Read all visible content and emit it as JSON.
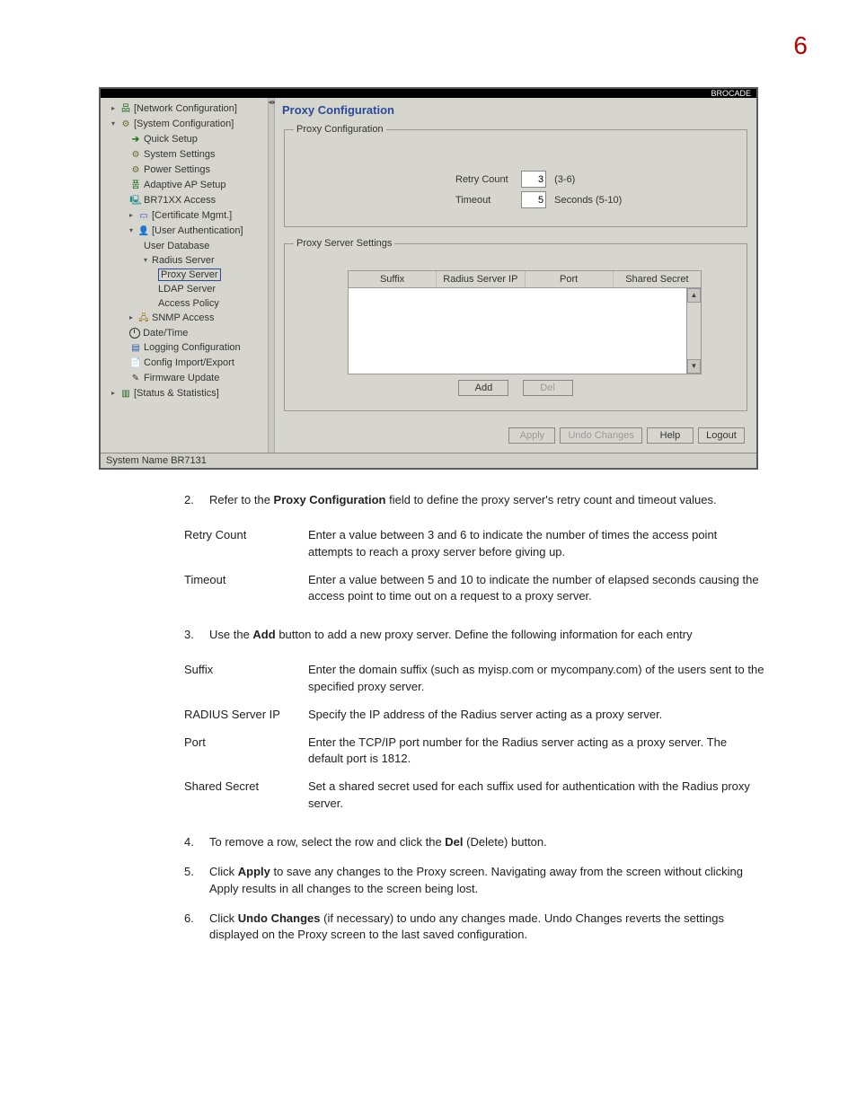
{
  "page_number": "6",
  "screenshot": {
    "brand": "BROCADE",
    "tree": {
      "network_config": "[Network Configuration]",
      "system_config": "[System Configuration]",
      "quick_setup": "Quick Setup",
      "system_settings": "System Settings",
      "power_settings": "Power Settings",
      "adaptive_ap": "Adaptive AP Setup",
      "br71xx": "BR71XX Access",
      "cert_mgmt": "[Certificate Mgmt.]",
      "user_auth": "[User Authentication]",
      "user_db": "User Database",
      "radius_server": "Radius Server",
      "proxy_server": "Proxy Server",
      "ldap_server": "LDAP Server",
      "access_policy": "Access Policy",
      "snmp": "SNMP Access",
      "datetime": "Date/Time",
      "logging": "Logging Configuration",
      "config_ie": "Config Import/Export",
      "firmware": "Firmware Update",
      "stats": "[Status & Statistics]"
    },
    "content": {
      "title": "Proxy Configuration",
      "group1_legend": "Proxy Configuration",
      "retry_label": "Retry Count",
      "retry_value": "3",
      "retry_hint": "(3-6)",
      "timeout_label": "Timeout",
      "timeout_value": "5",
      "timeout_hint": "Seconds (5-10)",
      "group2_legend": "Proxy Server Settings",
      "col_suffix": "Suffix",
      "col_radius": "Radius Server IP",
      "col_port": "Port",
      "col_secret": "Shared Secret",
      "btn_add": "Add",
      "btn_del": "Del",
      "btn_apply": "Apply",
      "btn_undo": "Undo Changes",
      "btn_help": "Help",
      "btn_logout": "Logout"
    },
    "status": "System Name BR7131"
  },
  "doc": {
    "step2": {
      "num": "2.",
      "pre": "Refer to the ",
      "bold": "Proxy Configuration",
      "post": " field to define the proxy server's retry count and timeout values."
    },
    "def1": {
      "retry_term": "Retry Count",
      "retry_desc": "Enter a value between 3 and 6 to indicate the number of times the access point attempts to reach a proxy server before giving up.",
      "timeout_term": "Timeout",
      "timeout_desc": "Enter a value between 5 and 10 to indicate the number of elapsed seconds causing the access point to time out on a request to a proxy server."
    },
    "step3": {
      "num": "3.",
      "pre": "Use the ",
      "bold": "Add",
      "post": " button to add a new proxy server. Define the following information for each entry"
    },
    "def2": {
      "suffix_term": "Suffix",
      "suffix_desc": "Enter the domain suffix (such as myisp.com or mycompany.com) of the users sent to the specified proxy server.",
      "radius_term": "RADIUS Server IP",
      "radius_desc": "Specify the IP address of the Radius server acting as a proxy server.",
      "port_term": "Port",
      "port_desc": "Enter the TCP/IP port number for the Radius server acting as a proxy server. The default port is 1812.",
      "secret_term": "Shared Secret",
      "secret_desc": "Set a shared secret used for each suffix used for authentication with the Radius proxy server."
    },
    "step4": {
      "num": "4.",
      "pre": "To remove a row, select the row and click the ",
      "bold": "Del",
      "post": " (Delete) button."
    },
    "step5": {
      "num": "5.",
      "pre": "Click ",
      "bold": "Apply",
      "post": " to save any changes to the Proxy screen. Navigating away from the screen without clicking Apply results in all changes to the screen being lost."
    },
    "step6": {
      "num": "6.",
      "pre": "Click ",
      "bold": "Undo Changes",
      "post": " (if necessary) to undo any changes made. Undo Changes reverts the settings displayed on the Proxy screen to the last saved configuration."
    }
  }
}
